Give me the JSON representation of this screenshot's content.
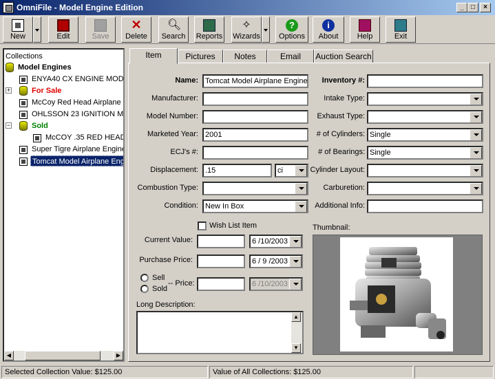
{
  "window": {
    "title": "OmniFile - Model Engine Edition"
  },
  "toolbar": {
    "new": "New",
    "edit": "Edit",
    "save": "Save",
    "delete": "Delete",
    "search": "Search",
    "reports": "Reports",
    "wizards": "Wizards",
    "options": "Options",
    "about": "About",
    "help": "Help",
    "exit": "Exit"
  },
  "tree": {
    "root": "Collections",
    "group1": "Model Engines",
    "items": [
      "ENYA40 CX ENGINE MODE",
      "For Sale",
      "McCoy Red Head Airplane E",
      "OHLSSON 23 IGNITION MO",
      "Sold",
      "McCOY .35 RED HEAD",
      "Super Tigre Airplane Engine",
      "Tomcat Model Airplane Eng"
    ]
  },
  "tabs": [
    "Item",
    "Pictures",
    "Notes",
    "Email",
    "Auction Search"
  ],
  "form": {
    "name_label": "Name:",
    "name_value": "Tomcat Model Airplane Engine",
    "manufacturer_label": "Manufacturer:",
    "manufacturer_value": "",
    "model_label": "Model Number:",
    "model_value": "",
    "year_label": "Marketed Year:",
    "year_value": "2001",
    "ecj_label": "ECJ's #:",
    "ecj_value": "",
    "displacement_label": "Displacement:",
    "displacement_value": ".15",
    "displacement_unit": "ci",
    "combustion_label": "Combustion Type:",
    "combustion_value": "",
    "condition_label": "Condition:",
    "condition_value": "New In Box",
    "inventory_label": "Inventory #:",
    "inventory_value": "",
    "intake_label": "Intake Type:",
    "intake_value": "",
    "exhaust_label": "Exhaust Type:",
    "exhaust_value": "",
    "cylinders_label": "# of Cylinders:",
    "cylinders_value": "Single",
    "bearings_label": "# of Bearings:",
    "bearings_value": "Single",
    "layout_label": "Cylinder Layout:",
    "layout_value": "",
    "carb_label": "Carburetion:",
    "carb_value": "",
    "addl_label": "Additional Info:",
    "addl_value": "",
    "wish_label": "Wish List Item",
    "current_label": "Current Value:",
    "current_value": "",
    "current_date": "6 /10/2003",
    "purchase_label": "Purchase Price:",
    "purchase_value": "",
    "purchase_date": "6 / 9 /2003",
    "sell_label": "Sell",
    "sold_label": "Sold",
    "price_label": "-- Price:",
    "price_value": "",
    "price_date": "6 /10/2003",
    "thumb_label": "Thumbnail:",
    "desc_label": "Long Description:"
  },
  "status": {
    "selected": "Selected Collection Value:  $125.00",
    "all": "Value of All Collections:  $125.00"
  }
}
